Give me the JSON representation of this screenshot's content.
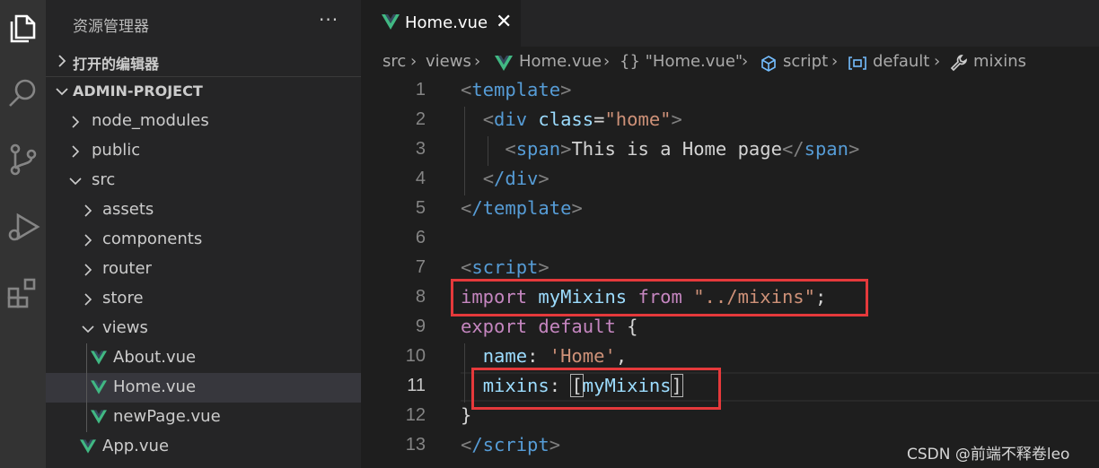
{
  "sidebar": {
    "title": "资源管理器",
    "more": "···",
    "open_editors_label": "打开的编辑器",
    "project_label": "ADMIN-PROJECT",
    "tree": [
      {
        "label": "node_modules",
        "kind": "folder",
        "open": false,
        "depth": 1
      },
      {
        "label": "public",
        "kind": "folder",
        "open": false,
        "depth": 1
      },
      {
        "label": "src",
        "kind": "folder",
        "open": true,
        "depth": 1
      },
      {
        "label": "assets",
        "kind": "folder",
        "open": false,
        "depth": 2
      },
      {
        "label": "components",
        "kind": "folder",
        "open": false,
        "depth": 2
      },
      {
        "label": "router",
        "kind": "folder",
        "open": false,
        "depth": 2
      },
      {
        "label": "store",
        "kind": "folder",
        "open": false,
        "depth": 2
      },
      {
        "label": "views",
        "kind": "folder",
        "open": true,
        "depth": 2
      },
      {
        "label": "About.vue",
        "kind": "vue",
        "depth": 3
      },
      {
        "label": "Home.vue",
        "kind": "vue",
        "depth": 3,
        "selected": true
      },
      {
        "label": "newPage.vue",
        "kind": "vue",
        "depth": 3
      },
      {
        "label": "App.vue",
        "kind": "vue",
        "depth": 2
      }
    ]
  },
  "tab": {
    "label": "Home.vue",
    "close": "✕"
  },
  "breadcrumb": {
    "src": "src",
    "views": "views",
    "file": "Home.vue",
    "module": "{} \"Home.vue\"",
    "script": "script",
    "default": "default",
    "mixins": "mixins"
  },
  "code": {
    "line_numbers": [
      "1",
      "2",
      "3",
      "4",
      "5",
      "6",
      "7",
      "8",
      "9",
      "10",
      "11",
      "12",
      "13"
    ],
    "active_line": "11",
    "l1_tag": "template",
    "l2_tag": "div",
    "l2_attr": "class",
    "l2_val": "\"home\"",
    "l3_tag": "span",
    "l3_text": "This is a Home page",
    "l4_tag": "/div",
    "l5_tag": "/template",
    "l7_tag": "script",
    "l8_import": "import",
    "l8_name": "myMixins",
    "l8_from": "from",
    "l8_path": "\"../mixins\"",
    "l8_end": ";",
    "l9_export": "export",
    "l9_default": "default",
    "l9_brace": "{",
    "l10_key": "name",
    "l10_val": "'Home'",
    "l10_end": ",",
    "l11_key": "mixins",
    "l11_val": "myMixins",
    "l12_brace": "}",
    "l13_tag": "/script"
  },
  "watermark": "CSDN @前端不释卷leo",
  "colors": {
    "highlight_box": "#e5393b",
    "vue_green": "#41b883",
    "tag_blue": "#569cd6",
    "keyword_purple": "#c586c0",
    "string_orange": "#ce9178"
  }
}
